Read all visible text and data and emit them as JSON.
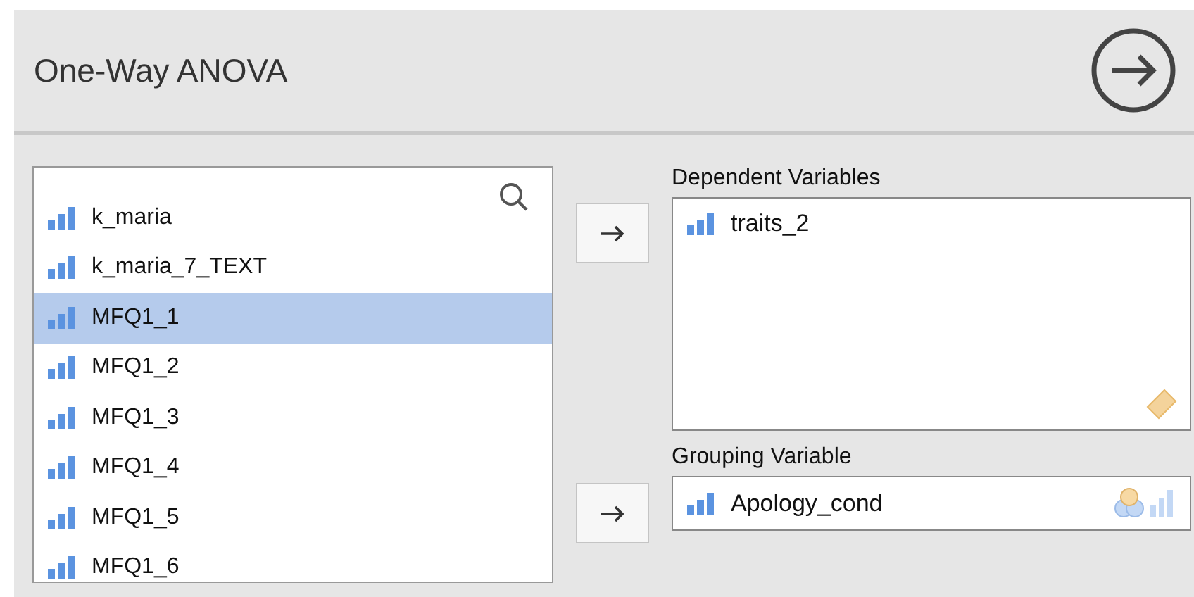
{
  "header": {
    "title": "One-Way ANOVA"
  },
  "variables": [
    {
      "name": "k_maria",
      "selected": false
    },
    {
      "name": "k_maria_7_TEXT",
      "selected": false
    },
    {
      "name": "MFQ1_1",
      "selected": true
    },
    {
      "name": "MFQ1_2",
      "selected": false
    },
    {
      "name": "MFQ1_3",
      "selected": false
    },
    {
      "name": "MFQ1_4",
      "selected": false
    },
    {
      "name": "MFQ1_5",
      "selected": false
    },
    {
      "name": "MFQ1_6",
      "selected": false
    }
  ],
  "targets": [
    {
      "kind": "multi",
      "label": "Dependent Variables",
      "items": [
        "traits_2"
      ]
    },
    {
      "kind": "single",
      "label": "Grouping Variable",
      "items": [
        "Apology_cond"
      ]
    }
  ]
}
